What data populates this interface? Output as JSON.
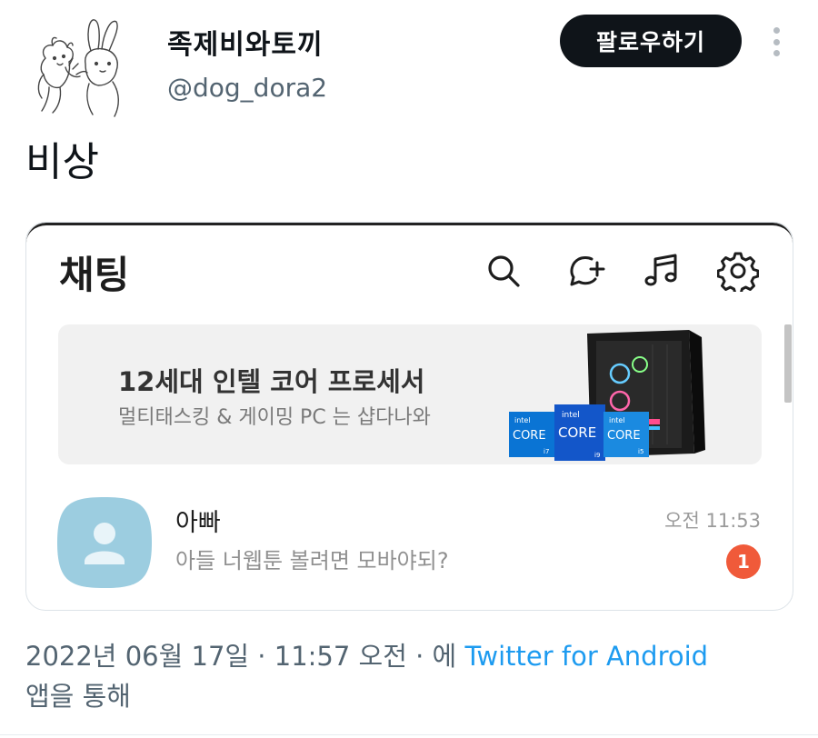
{
  "tweet": {
    "display_name": "족제비와토끼",
    "handle": "@dog_dora2",
    "follow_label": "팔로우하기",
    "text": "비상",
    "date_text": "2022년 06월 17일 · 11:57 오전 · 에 ",
    "source_app": "Twitter for Android",
    "via_text": "앱을 통해",
    "colors": {
      "accent": "#1d9bf0",
      "primary_text": "#0f1419",
      "secondary_text": "#536471"
    }
  },
  "screenshot": {
    "title": "채팅",
    "icons": [
      "search-icon",
      "new-chat-icon",
      "music-icon",
      "settings-icon"
    ],
    "ad": {
      "title": "12세대 인텔 코어 프로세서",
      "subtitle": "멀티태스킹 & 게이밍 PC 는 샵다나와",
      "chips": [
        {
          "brand": "intel",
          "label": "CORE",
          "tier": "i7"
        },
        {
          "brand": "intel",
          "label": "CORE",
          "tier": "i9"
        },
        {
          "brand": "intel",
          "label": "CORE",
          "tier": "i5"
        }
      ]
    },
    "chat": {
      "name": "아빠",
      "preview": "아들 너웹툰 볼려면 모바야되?",
      "time": "오전 11:53",
      "unread": "1"
    }
  }
}
